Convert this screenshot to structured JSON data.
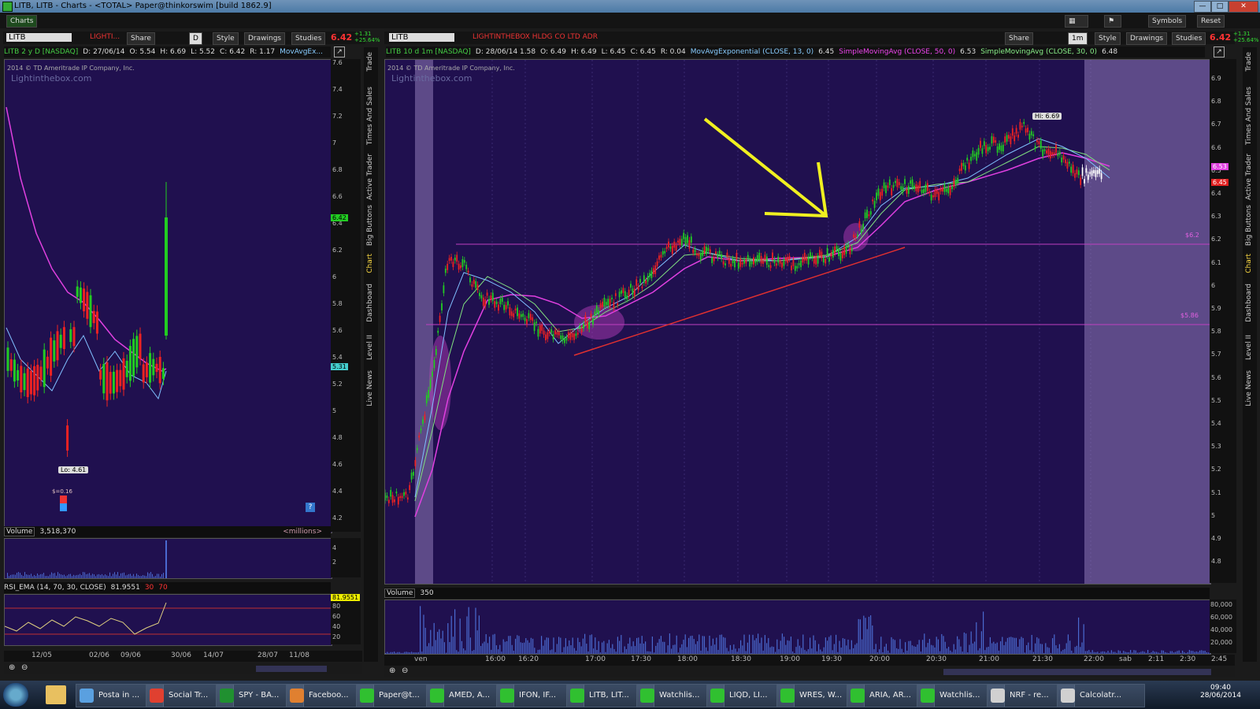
{
  "window": {
    "title": "LITB, LITB - Charts - <TOTAL> Paper@thinkorswim [build 1862.9]"
  },
  "appbar": {
    "charts_label": "Charts",
    "symbols": "Symbols",
    "reset": "Reset"
  },
  "left_chart": {
    "symbol": "LITB",
    "company_short": "LIGHTI...",
    "share": "Share",
    "style": "Style",
    "drawings": "Drawings",
    "studies": "Studies",
    "period_btn": "D",
    "price": "6.42",
    "change": "+1.31",
    "change_pct": "+25.64%",
    "info": {
      "label": "LITB 2 y D [NASDAQ]",
      "d": "D: 27/06/14",
      "o": "O: 5.54",
      "h": "H: 6.69",
      "l": "L: 5.52",
      "c": "C: 6.42",
      "r": "R: 1.17",
      "study": "MovAvgEx..."
    },
    "copyright": "2014 © TD Ameritrade IP Company, Inc.",
    "watermark": "Lightinthebox.com",
    "lo_label": "Lo: 4.61",
    "event_label": "$=0.16",
    "help": "?",
    "y_ticks": [
      "7.6",
      "7.4",
      "7.2",
      "7",
      "6.8",
      "6.6",
      "6.4",
      "6.2",
      "6",
      "5.8",
      "5.6",
      "5.4",
      "5.2",
      "5",
      "4.8",
      "4.6",
      "4.4",
      "4.2"
    ],
    "price_tags": {
      "last": "6.42",
      "ma": "5.31"
    },
    "volume_label": "Volume",
    "volume_value": "3,518,370",
    "volume_unit": "<millions>",
    "volume_ticks": [
      "4",
      "2"
    ],
    "rsi_label": "RSI_EMA (14, 70, 30, CLOSE)",
    "rsi_value": "81.9551",
    "rsi_lo": "30",
    "rsi_hi": "70",
    "rsi_tag": "81.9551",
    "rsi_ticks": [
      "80",
      "60",
      "40",
      "20"
    ],
    "x_ticks": [
      "12/05",
      "02/06",
      "09/06",
      "30/06",
      "14/07",
      "28/07",
      "11/08"
    ]
  },
  "right_chart": {
    "symbol": "LITB",
    "company": "LIGHTINTHEBOX HLDG CO LTD ADR",
    "share": "Share",
    "period_btn": "1m",
    "style": "Style",
    "drawings": "Drawings",
    "studies": "Studies",
    "price": "6.42",
    "change": "+1.31",
    "change_pct": "+25.64%",
    "info": {
      "label": "LITB 10 d 1m [NASDAQ]",
      "d": "D: 28/06/14 1.58",
      "o": "O: 6.49",
      "h": "H: 6.49",
      "l": "L: 6.45",
      "c": "C: 6.45",
      "r": "R: 0.04",
      "ema": "MovAvgExponential (CLOSE, 13, 0)",
      "ema_v": "6.45",
      "sma50": "SimpleMovingAvg (CLOSE, 50, 0)",
      "sma50_v": "6.53",
      "sma30": "SimpleMovingAvg (CLOSE, 30, 0)",
      "sma30_v": "6.48"
    },
    "copyright": "2014 © TD Ameritrade IP Company, Inc.",
    "watermark": "Lightinthebox.com",
    "hi_label": "Hi: 6.69",
    "level_1": "$6.2",
    "level_2": "$5.86",
    "price_tags": {
      "sma50": "6.53",
      "last": "6.45"
    },
    "y_ticks": [
      "6.9",
      "6.8",
      "6.7",
      "6.6",
      "6.5",
      "6.4",
      "6.3",
      "6.2",
      "6.1",
      "6",
      "5.9",
      "5.8",
      "5.7",
      "5.6",
      "5.5",
      "5.4",
      "5.3",
      "5.2",
      "5.1",
      "5",
      "4.9",
      "4.8"
    ],
    "volume_label": "Volume",
    "volume_value": "350",
    "volume_ticks": [
      "80,000",
      "60,000",
      "40,000",
      "20,000"
    ],
    "x_ticks": [
      "ven",
      "16:00",
      "16:20",
      "17:00",
      "17:30",
      "18:00",
      "18:30",
      "19:00",
      "19:30",
      "20:00",
      "20:30",
      "21:00",
      "21:30",
      "22:00",
      "sab",
      "2:11",
      "2:30",
      "2:45"
    ]
  },
  "side_tabs": [
    "Trade",
    "Times And Sales",
    "Active Trader",
    "Big Buttons",
    "Chart",
    "Dashboard",
    "Level II",
    "Live News"
  ],
  "taskbar": {
    "items": [
      "Posta in ...",
      "Social Tr...",
      "SPY - BA...",
      "Faceboo...",
      "Paper@t...",
      "AMED, A...",
      "IFON, IF...",
      "LITB, LIT...",
      "Watchlis...",
      "LIQD, LI...",
      "WRES, W...",
      "ARIA, AR...",
      "Watchlis...",
      "NRF - re...",
      "Calcolatr..."
    ],
    "time": "09:40",
    "date": "28/06/2014"
  },
  "colors": {
    "chart_bg": "#20104f",
    "shade": "#8f7ab8",
    "sma50": "#e040e0",
    "sma30": "#80e080",
    "ema": "#80c0ff",
    "arrow": "#f0f020",
    "trend": "#e03030",
    "level": "#c040c0"
  }
}
